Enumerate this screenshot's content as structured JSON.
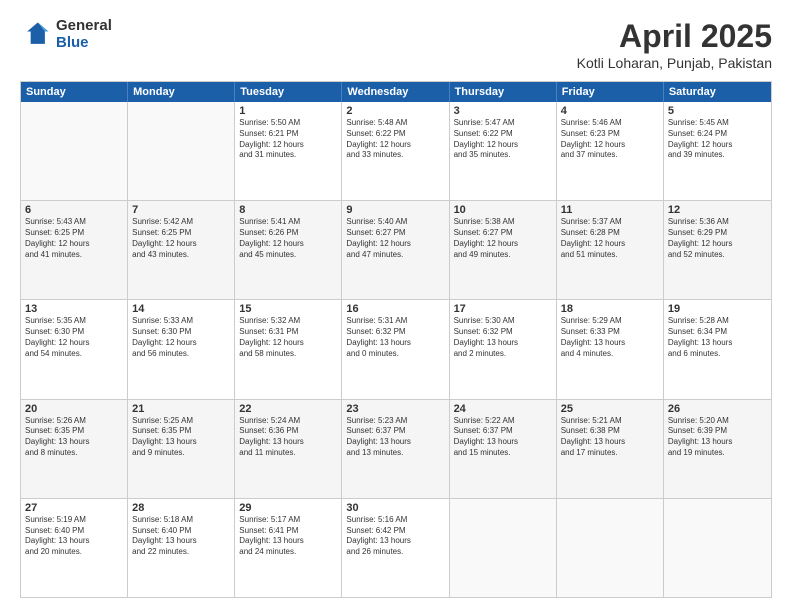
{
  "logo": {
    "general": "General",
    "blue": "Blue"
  },
  "title": "April 2025",
  "subtitle": "Kotli Loharan, Punjab, Pakistan",
  "header_days": [
    "Sunday",
    "Monday",
    "Tuesday",
    "Wednesday",
    "Thursday",
    "Friday",
    "Saturday"
  ],
  "rows": [
    [
      {
        "day": "",
        "info": ""
      },
      {
        "day": "",
        "info": ""
      },
      {
        "day": "1",
        "info": "Sunrise: 5:50 AM\nSunset: 6:21 PM\nDaylight: 12 hours\nand 31 minutes."
      },
      {
        "day": "2",
        "info": "Sunrise: 5:48 AM\nSunset: 6:22 PM\nDaylight: 12 hours\nand 33 minutes."
      },
      {
        "day": "3",
        "info": "Sunrise: 5:47 AM\nSunset: 6:22 PM\nDaylight: 12 hours\nand 35 minutes."
      },
      {
        "day": "4",
        "info": "Sunrise: 5:46 AM\nSunset: 6:23 PM\nDaylight: 12 hours\nand 37 minutes."
      },
      {
        "day": "5",
        "info": "Sunrise: 5:45 AM\nSunset: 6:24 PM\nDaylight: 12 hours\nand 39 minutes."
      }
    ],
    [
      {
        "day": "6",
        "info": "Sunrise: 5:43 AM\nSunset: 6:25 PM\nDaylight: 12 hours\nand 41 minutes."
      },
      {
        "day": "7",
        "info": "Sunrise: 5:42 AM\nSunset: 6:25 PM\nDaylight: 12 hours\nand 43 minutes."
      },
      {
        "day": "8",
        "info": "Sunrise: 5:41 AM\nSunset: 6:26 PM\nDaylight: 12 hours\nand 45 minutes."
      },
      {
        "day": "9",
        "info": "Sunrise: 5:40 AM\nSunset: 6:27 PM\nDaylight: 12 hours\nand 47 minutes."
      },
      {
        "day": "10",
        "info": "Sunrise: 5:38 AM\nSunset: 6:27 PM\nDaylight: 12 hours\nand 49 minutes."
      },
      {
        "day": "11",
        "info": "Sunrise: 5:37 AM\nSunset: 6:28 PM\nDaylight: 12 hours\nand 51 minutes."
      },
      {
        "day": "12",
        "info": "Sunrise: 5:36 AM\nSunset: 6:29 PM\nDaylight: 12 hours\nand 52 minutes."
      }
    ],
    [
      {
        "day": "13",
        "info": "Sunrise: 5:35 AM\nSunset: 6:30 PM\nDaylight: 12 hours\nand 54 minutes."
      },
      {
        "day": "14",
        "info": "Sunrise: 5:33 AM\nSunset: 6:30 PM\nDaylight: 12 hours\nand 56 minutes."
      },
      {
        "day": "15",
        "info": "Sunrise: 5:32 AM\nSunset: 6:31 PM\nDaylight: 12 hours\nand 58 minutes."
      },
      {
        "day": "16",
        "info": "Sunrise: 5:31 AM\nSunset: 6:32 PM\nDaylight: 13 hours\nand 0 minutes."
      },
      {
        "day": "17",
        "info": "Sunrise: 5:30 AM\nSunset: 6:32 PM\nDaylight: 13 hours\nand 2 minutes."
      },
      {
        "day": "18",
        "info": "Sunrise: 5:29 AM\nSunset: 6:33 PM\nDaylight: 13 hours\nand 4 minutes."
      },
      {
        "day": "19",
        "info": "Sunrise: 5:28 AM\nSunset: 6:34 PM\nDaylight: 13 hours\nand 6 minutes."
      }
    ],
    [
      {
        "day": "20",
        "info": "Sunrise: 5:26 AM\nSunset: 6:35 PM\nDaylight: 13 hours\nand 8 minutes."
      },
      {
        "day": "21",
        "info": "Sunrise: 5:25 AM\nSunset: 6:35 PM\nDaylight: 13 hours\nand 9 minutes."
      },
      {
        "day": "22",
        "info": "Sunrise: 5:24 AM\nSunset: 6:36 PM\nDaylight: 13 hours\nand 11 minutes."
      },
      {
        "day": "23",
        "info": "Sunrise: 5:23 AM\nSunset: 6:37 PM\nDaylight: 13 hours\nand 13 minutes."
      },
      {
        "day": "24",
        "info": "Sunrise: 5:22 AM\nSunset: 6:37 PM\nDaylight: 13 hours\nand 15 minutes."
      },
      {
        "day": "25",
        "info": "Sunrise: 5:21 AM\nSunset: 6:38 PM\nDaylight: 13 hours\nand 17 minutes."
      },
      {
        "day": "26",
        "info": "Sunrise: 5:20 AM\nSunset: 6:39 PM\nDaylight: 13 hours\nand 19 minutes."
      }
    ],
    [
      {
        "day": "27",
        "info": "Sunrise: 5:19 AM\nSunset: 6:40 PM\nDaylight: 13 hours\nand 20 minutes."
      },
      {
        "day": "28",
        "info": "Sunrise: 5:18 AM\nSunset: 6:40 PM\nDaylight: 13 hours\nand 22 minutes."
      },
      {
        "day": "29",
        "info": "Sunrise: 5:17 AM\nSunset: 6:41 PM\nDaylight: 13 hours\nand 24 minutes."
      },
      {
        "day": "30",
        "info": "Sunrise: 5:16 AM\nSunset: 6:42 PM\nDaylight: 13 hours\nand 26 minutes."
      },
      {
        "day": "",
        "info": ""
      },
      {
        "day": "",
        "info": ""
      },
      {
        "day": "",
        "info": ""
      }
    ]
  ]
}
